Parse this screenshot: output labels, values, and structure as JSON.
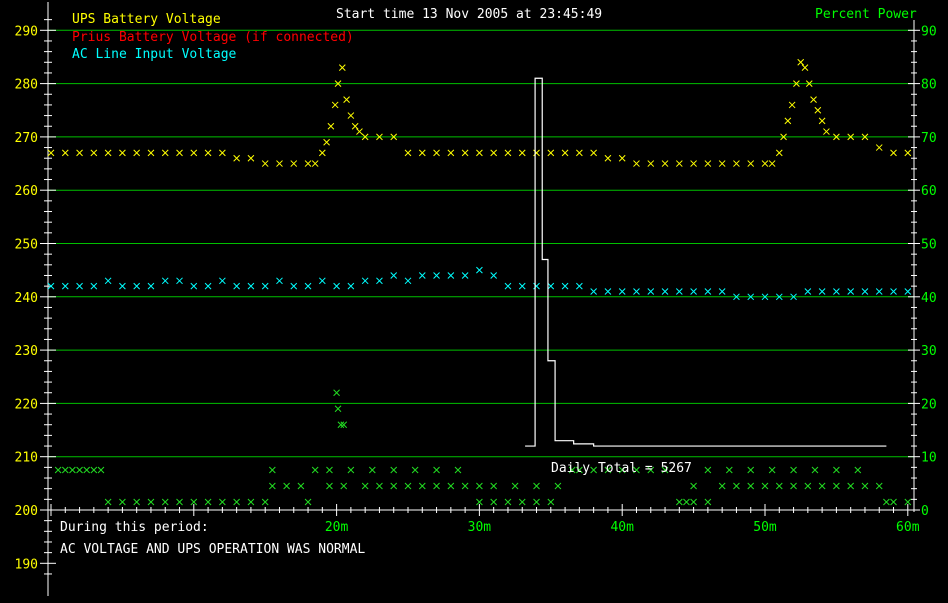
{
  "header": {
    "start_time": "Start time 13 Nov 2005 at 23:45:49",
    "right_axis_title": "Percent Power"
  },
  "status": {
    "line1": "During this period:",
    "line2": "AC VOLTAGE AND UPS OPERATION WAS NORMAL"
  },
  "daily_total_label": "Daily Total = 5267",
  "colors": {
    "background": "#000000",
    "grid": "#00c000",
    "axis": "#ffffff",
    "left_ticks": "#ffff00",
    "right_ticks": "#00ff00",
    "ups": "#ffff00",
    "prius": "#ff0000",
    "ac": "#00ffff",
    "green_marks": "#22dd22",
    "power": "#ffffff",
    "status_text": "#ffffff"
  },
  "chart_data": {
    "type": "scatter",
    "x_unit": "minutes",
    "xlim": [
      0,
      60
    ],
    "x_ticks": [
      {
        "value": 20,
        "label": "20m"
      },
      {
        "value": 30,
        "label": "30m"
      },
      {
        "value": 40,
        "label": "40m"
      },
      {
        "value": 50,
        "label": "50m"
      },
      {
        "value": 60,
        "label": "60m"
      }
    ],
    "left_axis": {
      "ylim": [
        187,
        293
      ],
      "ticks": [
        {
          "value": 290,
          "label": "290"
        },
        {
          "value": 280,
          "label": "280"
        },
        {
          "value": 270,
          "label": "270"
        },
        {
          "value": 260,
          "label": "260"
        },
        {
          "value": 250,
          "label": "250"
        },
        {
          "value": 240,
          "label": "240"
        },
        {
          "value": 230,
          "label": "230"
        },
        {
          "value": 220,
          "label": "220"
        },
        {
          "value": 210,
          "label": "210"
        },
        {
          "value": 200,
          "label": "200"
        },
        {
          "value": 190,
          "label": "190"
        }
      ]
    },
    "right_axis": {
      "ylim": [
        -3,
        93
      ],
      "ticks": [
        {
          "value": 90,
          "label": "90"
        },
        {
          "value": 80,
          "label": "80"
        },
        {
          "value": 70,
          "label": "70"
        },
        {
          "value": 60,
          "label": "60"
        },
        {
          "value": 50,
          "label": "50"
        },
        {
          "value": 40,
          "label": "40"
        },
        {
          "value": 30,
          "label": "30"
        },
        {
          "value": 20,
          "label": "20"
        },
        {
          "value": 10,
          "label": "10"
        },
        {
          "value": 0,
          "label": "0"
        }
      ]
    },
    "grid": true,
    "legend": {
      "placement": "top-left",
      "entries": [
        {
          "label": "UPS Battery Voltage",
          "color": "#ffff00"
        },
        {
          "label": "Prius Battery Voltage (if connected)",
          "color": "#ff0000"
        },
        {
          "label": "AC Line Input Voltage",
          "color": "#00ffff"
        }
      ]
    },
    "series": [
      {
        "name": "UPS Battery Voltage",
        "axis": "left",
        "color": "#ffff00",
        "points": [
          [
            0,
            267
          ],
          [
            1,
            267
          ],
          [
            2,
            267
          ],
          [
            3,
            267
          ],
          [
            4,
            267
          ],
          [
            5,
            267
          ],
          [
            6,
            267
          ],
          [
            7,
            267
          ],
          [
            8,
            267
          ],
          [
            9,
            267
          ],
          [
            10,
            267
          ],
          [
            11,
            267
          ],
          [
            12,
            267
          ],
          [
            13,
            266
          ],
          [
            14,
            266
          ],
          [
            15,
            265
          ],
          [
            16,
            265
          ],
          [
            17,
            265
          ],
          [
            18,
            265
          ],
          [
            18.5,
            265
          ],
          [
            19,
            267
          ],
          [
            19.3,
            269
          ],
          [
            19.6,
            272
          ],
          [
            19.9,
            276
          ],
          [
            20.1,
            280
          ],
          [
            20.4,
            283
          ],
          [
            20.7,
            277
          ],
          [
            21,
            274
          ],
          [
            21.3,
            272
          ],
          [
            21.6,
            271
          ],
          [
            22,
            270
          ],
          [
            23,
            270
          ],
          [
            24,
            270
          ],
          [
            25,
            267
          ],
          [
            26,
            267
          ],
          [
            27,
            267
          ],
          [
            28,
            267
          ],
          [
            29,
            267
          ],
          [
            30,
            267
          ],
          [
            31,
            267
          ],
          [
            32,
            267
          ],
          [
            33,
            267
          ],
          [
            34,
            267
          ],
          [
            35,
            267
          ],
          [
            36,
            267
          ],
          [
            37,
            267
          ],
          [
            38,
            267
          ],
          [
            39,
            266
          ],
          [
            40,
            266
          ],
          [
            41,
            265
          ],
          [
            42,
            265
          ],
          [
            43,
            265
          ],
          [
            44,
            265
          ],
          [
            45,
            265
          ],
          [
            46,
            265
          ],
          [
            47,
            265
          ],
          [
            48,
            265
          ],
          [
            49,
            265
          ],
          [
            50,
            265
          ],
          [
            50.5,
            265
          ],
          [
            51,
            267
          ],
          [
            51.3,
            270
          ],
          [
            51.6,
            273
          ],
          [
            51.9,
            276
          ],
          [
            52.2,
            280
          ],
          [
            52.5,
            284
          ],
          [
            52.8,
            283
          ],
          [
            53.1,
            280
          ],
          [
            53.4,
            277
          ],
          [
            53.7,
            275
          ],
          [
            54,
            273
          ],
          [
            54.3,
            271
          ],
          [
            55,
            270
          ],
          [
            56,
            270
          ],
          [
            57,
            270
          ],
          [
            58,
            268
          ],
          [
            59,
            267
          ],
          [
            60,
            267
          ]
        ]
      },
      {
        "name": "AC Line Input Voltage",
        "axis": "left",
        "color": "#00ffff",
        "points": [
          [
            0,
            242
          ],
          [
            1,
            242
          ],
          [
            2,
            242
          ],
          [
            3,
            242
          ],
          [
            4,
            243
          ],
          [
            5,
            242
          ],
          [
            6,
            242
          ],
          [
            7,
            242
          ],
          [
            8,
            243
          ],
          [
            9,
            243
          ],
          [
            10,
            242
          ],
          [
            11,
            242
          ],
          [
            12,
            243
          ],
          [
            13,
            242
          ],
          [
            14,
            242
          ],
          [
            15,
            242
          ],
          [
            16,
            243
          ],
          [
            17,
            242
          ],
          [
            18,
            242
          ],
          [
            19,
            243
          ],
          [
            20,
            242
          ],
          [
            21,
            242
          ],
          [
            22,
            243
          ],
          [
            23,
            243
          ],
          [
            24,
            244
          ],
          [
            25,
            243
          ],
          [
            26,
            244
          ],
          [
            27,
            244
          ],
          [
            28,
            244
          ],
          [
            29,
            244
          ],
          [
            30,
            245
          ],
          [
            31,
            244
          ],
          [
            32,
            242
          ],
          [
            33,
            242
          ],
          [
            34,
            242
          ],
          [
            35,
            242
          ],
          [
            36,
            242
          ],
          [
            37,
            242
          ],
          [
            38,
            241
          ],
          [
            39,
            241
          ],
          [
            40,
            241
          ],
          [
            41,
            241
          ],
          [
            42,
            241
          ],
          [
            43,
            241
          ],
          [
            44,
            241
          ],
          [
            45,
            241
          ],
          [
            46,
            241
          ],
          [
            47,
            241
          ],
          [
            48,
            240
          ],
          [
            49,
            240
          ],
          [
            50,
            240
          ],
          [
            51,
            240
          ],
          [
            52,
            240
          ],
          [
            53,
            241
          ],
          [
            54,
            241
          ],
          [
            55,
            241
          ],
          [
            56,
            241
          ],
          [
            57,
            241
          ],
          [
            58,
            241
          ],
          [
            59,
            241
          ],
          [
            60,
            241
          ]
        ]
      },
      {
        "name": "Percent Power",
        "axis": "right",
        "color": "#ffffff",
        "type": "step",
        "points": [
          [
            33.2,
            12
          ],
          [
            33.5,
            12
          ],
          [
            33.9,
            12
          ],
          [
            33.9,
            81
          ],
          [
            34.4,
            81
          ],
          [
            34.4,
            47
          ],
          [
            34.8,
            47
          ],
          [
            34.8,
            28
          ],
          [
            35.3,
            28
          ],
          [
            35.3,
            13
          ],
          [
            36.6,
            13
          ],
          [
            36.6,
            12.4
          ],
          [
            38,
            12.4
          ],
          [
            38,
            12
          ],
          [
            58.5,
            12
          ]
        ]
      },
      {
        "axis": "left",
        "color": "#22dd22",
        "points": [
          [
            20,
            222
          ],
          [
            20.1,
            219
          ],
          [
            20.3,
            216
          ],
          [
            20.5,
            216
          ],
          [
            0.5,
            207.5
          ],
          [
            1,
            207.5
          ],
          [
            1.5,
            207.5
          ],
          [
            2,
            207.5
          ],
          [
            2.5,
            207.5
          ],
          [
            3,
            207.5
          ],
          [
            3.5,
            207.5
          ],
          [
            4,
            201.5
          ],
          [
            5,
            201.5
          ],
          [
            6,
            201.5
          ],
          [
            7,
            201.5
          ],
          [
            8,
            201.5
          ],
          [
            9,
            201.5
          ],
          [
            10,
            201.5
          ],
          [
            11,
            201.5
          ],
          [
            12,
            201.5
          ],
          [
            13,
            201.5
          ],
          [
            14,
            201.5
          ],
          [
            15,
            201.5
          ],
          [
            15.5,
            207.5
          ],
          [
            15.5,
            204.5
          ],
          [
            16.5,
            204.5
          ],
          [
            17.5,
            204.5
          ],
          [
            18,
            201.5
          ],
          [
            18.5,
            207.5
          ],
          [
            19.5,
            204.5
          ],
          [
            19.5,
            207.5
          ],
          [
            20.5,
            204.5
          ],
          [
            21,
            207.5
          ],
          [
            22,
            204.5
          ],
          [
            22.5,
            207.5
          ],
          [
            23,
            204.5
          ],
          [
            24,
            204.5
          ],
          [
            24,
            207.5
          ],
          [
            25,
            204.5
          ],
          [
            25.5,
            207.5
          ],
          [
            26,
            204.5
          ],
          [
            27,
            204.5
          ],
          [
            27,
            207.5
          ],
          [
            28,
            204.5
          ],
          [
            28.5,
            207.5
          ],
          [
            29,
            204.5
          ],
          [
            30,
            204.5
          ],
          [
            30,
            201.5
          ],
          [
            31,
            204.5
          ],
          [
            31,
            201.5
          ],
          [
            32,
            201.5
          ],
          [
            32.5,
            204.5
          ],
          [
            33,
            201.5
          ],
          [
            34,
            201.5
          ],
          [
            34,
            204.5
          ],
          [
            35,
            201.5
          ],
          [
            35.5,
            204.5
          ],
          [
            36.5,
            207.5
          ],
          [
            37,
            207.5
          ],
          [
            38,
            207.5
          ],
          [
            39,
            207.5
          ],
          [
            40,
            207.5
          ],
          [
            41,
            207.5
          ],
          [
            42,
            207.5
          ],
          [
            43,
            207.5
          ],
          [
            44,
            201.5
          ],
          [
            44.5,
            201.5
          ],
          [
            45,
            201.5
          ],
          [
            45,
            204.5
          ],
          [
            46,
            201.5
          ],
          [
            46,
            207.5
          ],
          [
            47,
            204.5
          ],
          [
            47.5,
            207.5
          ],
          [
            48,
            204.5
          ],
          [
            49,
            204.5
          ],
          [
            49,
            207.5
          ],
          [
            50,
            204.5
          ],
          [
            50.5,
            207.5
          ],
          [
            51,
            204.5
          ],
          [
            52,
            204.5
          ],
          [
            52,
            207.5
          ],
          [
            53,
            204.5
          ],
          [
            53.5,
            207.5
          ],
          [
            54,
            204.5
          ],
          [
            55,
            204.5
          ],
          [
            55,
            207.5
          ],
          [
            56,
            204.5
          ],
          [
            56.5,
            207.5
          ],
          [
            57,
            204.5
          ],
          [
            58,
            204.5
          ],
          [
            58.5,
            201.5
          ],
          [
            59,
            201.5
          ],
          [
            60,
            201.5
          ]
        ]
      }
    ]
  }
}
